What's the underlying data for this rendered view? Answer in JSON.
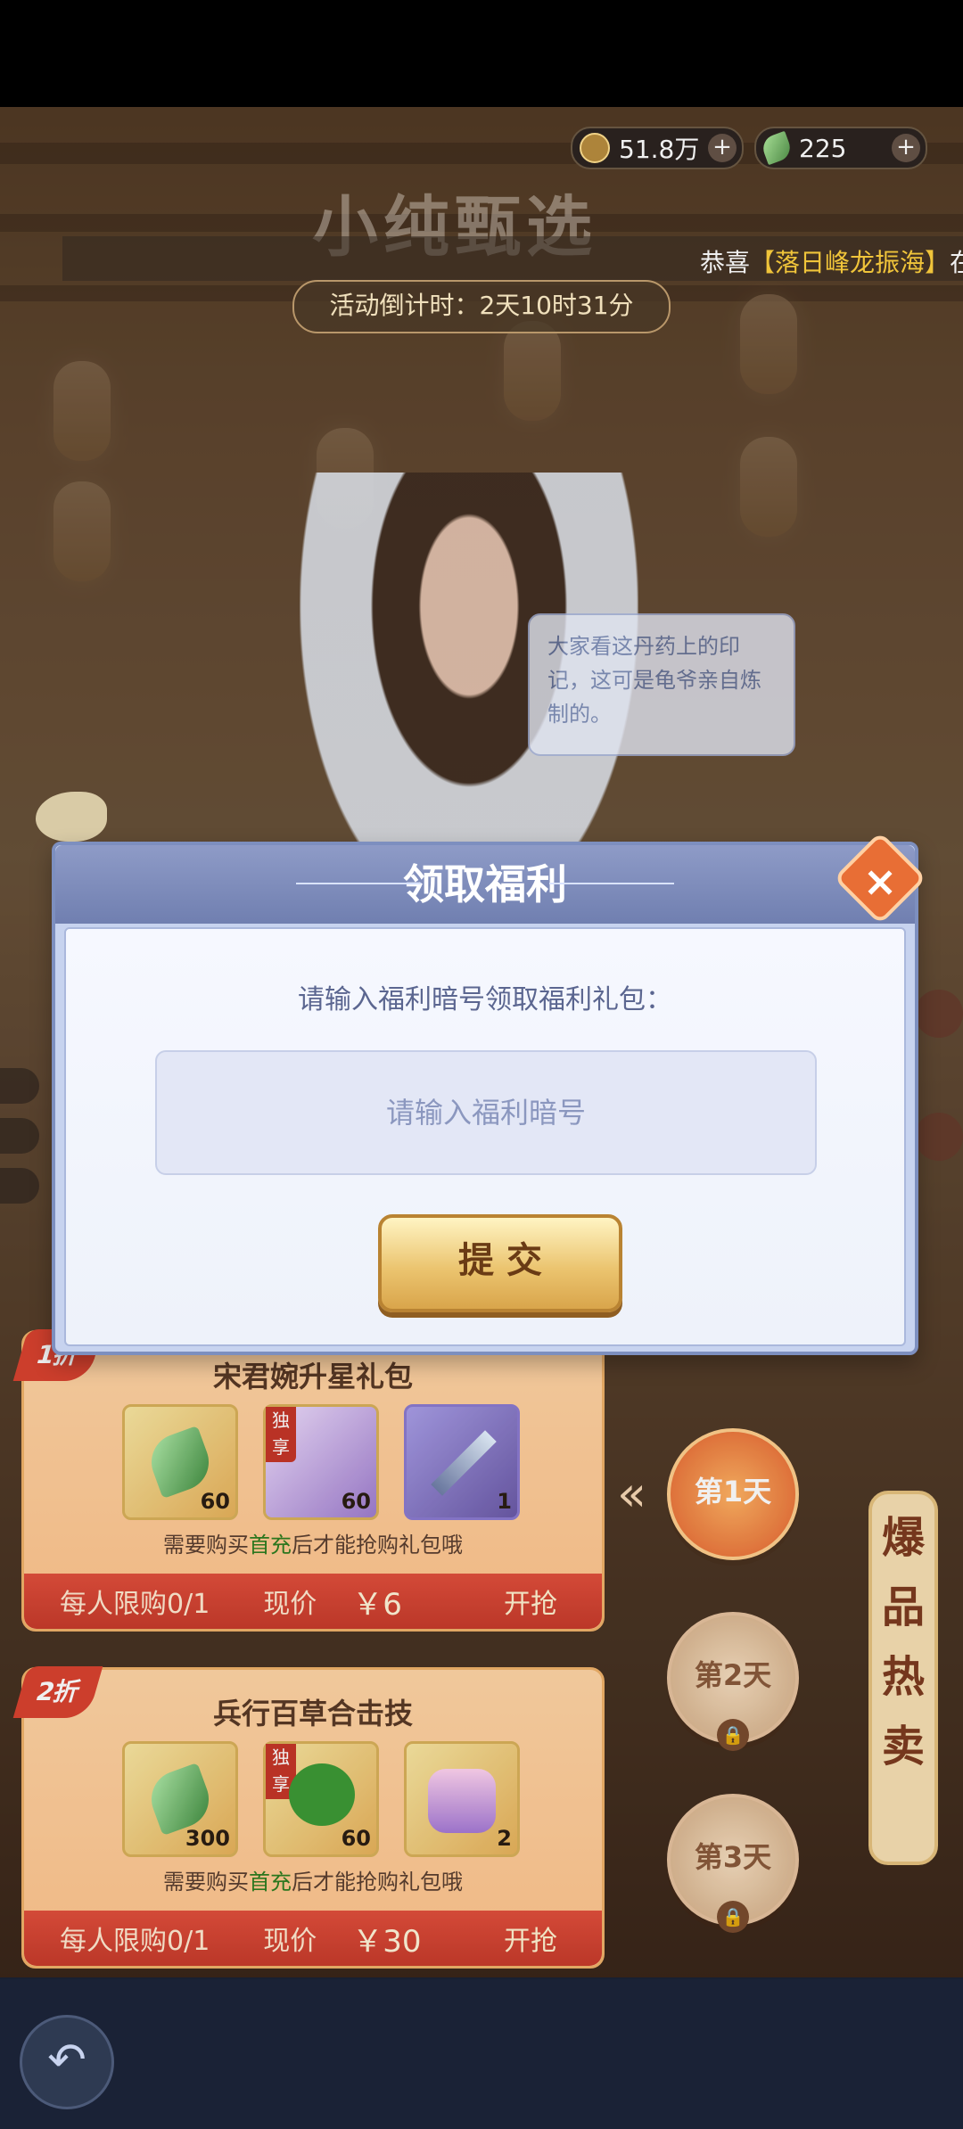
{
  "currencies": [
    {
      "icon": "coin-icon",
      "value": "51.8万"
    },
    {
      "icon": "leaf-icon",
      "value": "225"
    }
  ],
  "header": {
    "title": "小纯甄选",
    "marquee_prefix": "恭喜",
    "marquee_highlight": "【落日峰龙振海】",
    "marquee_suffix": "在",
    "countdown": "活动倒计时：2天10时31分"
  },
  "speech": {
    "text": "大家看这丹药上的印记，这可是龟爷亲自炼制的。"
  },
  "offers": [
    {
      "badge": "1折",
      "title": "宋君婉升星礼包",
      "items": [
        {
          "icon": "leaf-icon",
          "count": "60"
        },
        {
          "icon": "portrait-icon",
          "count": "60",
          "exclusive": "独享"
        },
        {
          "icon": "sword-icon",
          "count": "1"
        }
      ],
      "req_prefix": "需要购买",
      "req_highlight": "首充",
      "req_suffix": "后才能抢购礼包哦",
      "limit": "每人限购0/1",
      "price_label": "现价",
      "price": "￥6",
      "buy": "开抢"
    },
    {
      "badge": "2折",
      "title": "兵行百草合击技",
      "items": [
        {
          "icon": "leaf-icon",
          "count": "300"
        },
        {
          "icon": "tree-icon",
          "count": "60",
          "exclusive": "独享"
        },
        {
          "icon": "bag-icon",
          "count": "2"
        }
      ],
      "req_prefix": "需要购买",
      "req_highlight": "首充",
      "req_suffix": "后才能抢购礼包哦",
      "limit": "每人限购0/1",
      "price_label": "现价",
      "price": "￥30",
      "buy": "开抢"
    }
  ],
  "days": [
    {
      "label": "第1天",
      "locked": false
    },
    {
      "label": "第2天",
      "locked": true
    },
    {
      "label": "第3天",
      "locked": true
    }
  ],
  "side_tab": {
    "label": "爆品热卖"
  },
  "dialog": {
    "title": "领取福利",
    "label": "请输入福利暗号领取福利礼包：",
    "input_placeholder": "请输入福利暗号",
    "input_value": "",
    "submit": "提 交",
    "close_icon": "close-icon"
  },
  "bottom": {
    "back_icon": "back-arrow-icon"
  }
}
